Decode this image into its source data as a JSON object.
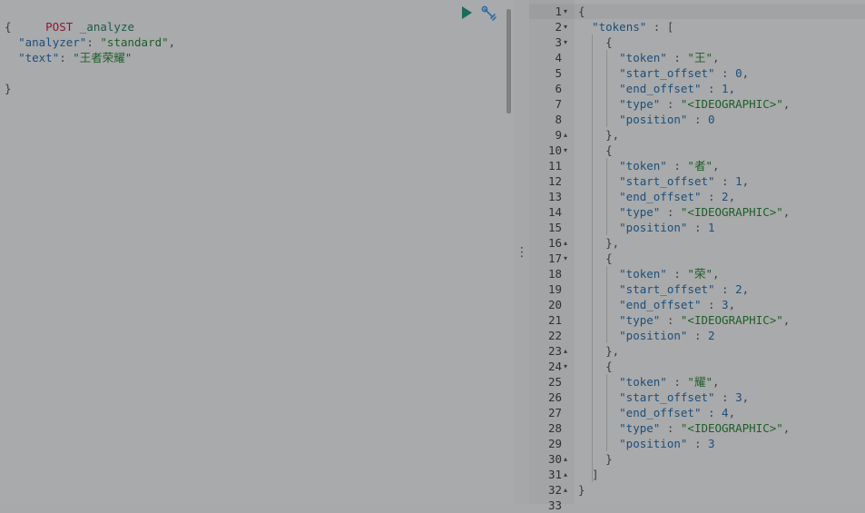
{
  "request": {
    "method": "POST",
    "path": "_analyze",
    "body_lines": [
      {
        "indent": "",
        "parts": [
          {
            "t": "{",
            "c": "brace"
          }
        ]
      },
      {
        "indent": "  ",
        "parts": [
          {
            "t": "\"analyzer\"",
            "c": "key"
          },
          {
            "t": ": ",
            "c": "punct"
          },
          {
            "t": "\"standard\"",
            "c": "str"
          },
          {
            "t": ",",
            "c": "punct"
          }
        ]
      },
      {
        "indent": "  ",
        "parts": [
          {
            "t": "\"text\"",
            "c": "key"
          },
          {
            "t": ": ",
            "c": "punct"
          },
          {
            "t": "\"王者荣耀\"",
            "c": "str"
          }
        ]
      },
      {
        "indent": "",
        "parts": []
      },
      {
        "indent": "",
        "parts": [
          {
            "t": "}",
            "c": "brace"
          }
        ]
      }
    ]
  },
  "actions": {
    "run_icon": "play-icon",
    "settings_icon": "wrench-icon",
    "run_color": "#1b6b5c",
    "settings_color": "#2b6ca8"
  },
  "divider": {
    "handle": "⋮"
  },
  "response": {
    "lines": [
      {
        "n": "1",
        "fold": "▾",
        "indent": "",
        "parts": [
          {
            "t": "{",
            "c": "brace"
          }
        ]
      },
      {
        "n": "2",
        "fold": "▾",
        "indent": "  ",
        "parts": [
          {
            "t": "\"tokens\"",
            "c": "key"
          },
          {
            "t": " : [",
            "c": "punct"
          }
        ]
      },
      {
        "n": "3",
        "fold": "▾",
        "indent": "    ",
        "parts": [
          {
            "t": "{",
            "c": "brace"
          }
        ]
      },
      {
        "n": "4",
        "fold": "",
        "indent": "      ",
        "parts": [
          {
            "t": "\"token\"",
            "c": "key"
          },
          {
            "t": " : ",
            "c": "punct"
          },
          {
            "t": "\"王\"",
            "c": "str"
          },
          {
            "t": ",",
            "c": "punct"
          }
        ]
      },
      {
        "n": "5",
        "fold": "",
        "indent": "      ",
        "parts": [
          {
            "t": "\"start_offset\"",
            "c": "key"
          },
          {
            "t": " : ",
            "c": "punct"
          },
          {
            "t": "0",
            "c": "num"
          },
          {
            "t": ",",
            "c": "punct"
          }
        ]
      },
      {
        "n": "6",
        "fold": "",
        "indent": "      ",
        "parts": [
          {
            "t": "\"end_offset\"",
            "c": "key"
          },
          {
            "t": " : ",
            "c": "punct"
          },
          {
            "t": "1",
            "c": "num"
          },
          {
            "t": ",",
            "c": "punct"
          }
        ]
      },
      {
        "n": "7",
        "fold": "",
        "indent": "      ",
        "parts": [
          {
            "t": "\"type\"",
            "c": "key"
          },
          {
            "t": " : ",
            "c": "punct"
          },
          {
            "t": "\"<IDEOGRAPHIC>\"",
            "c": "str"
          },
          {
            "t": ",",
            "c": "punct"
          }
        ]
      },
      {
        "n": "8",
        "fold": "",
        "indent": "      ",
        "parts": [
          {
            "t": "\"position\"",
            "c": "key"
          },
          {
            "t": " : ",
            "c": "punct"
          },
          {
            "t": "0",
            "c": "num"
          }
        ]
      },
      {
        "n": "9",
        "fold": "▴",
        "indent": "    ",
        "parts": [
          {
            "t": "},",
            "c": "brace"
          }
        ]
      },
      {
        "n": "10",
        "fold": "▾",
        "indent": "    ",
        "parts": [
          {
            "t": "{",
            "c": "brace"
          }
        ]
      },
      {
        "n": "11",
        "fold": "",
        "indent": "      ",
        "parts": [
          {
            "t": "\"token\"",
            "c": "key"
          },
          {
            "t": " : ",
            "c": "punct"
          },
          {
            "t": "\"者\"",
            "c": "str"
          },
          {
            "t": ",",
            "c": "punct"
          }
        ]
      },
      {
        "n": "12",
        "fold": "",
        "indent": "      ",
        "parts": [
          {
            "t": "\"start_offset\"",
            "c": "key"
          },
          {
            "t": " : ",
            "c": "punct"
          },
          {
            "t": "1",
            "c": "num"
          },
          {
            "t": ",",
            "c": "punct"
          }
        ]
      },
      {
        "n": "13",
        "fold": "",
        "indent": "      ",
        "parts": [
          {
            "t": "\"end_offset\"",
            "c": "key"
          },
          {
            "t": " : ",
            "c": "punct"
          },
          {
            "t": "2",
            "c": "num"
          },
          {
            "t": ",",
            "c": "punct"
          }
        ]
      },
      {
        "n": "14",
        "fold": "",
        "indent": "      ",
        "parts": [
          {
            "t": "\"type\"",
            "c": "key"
          },
          {
            "t": " : ",
            "c": "punct"
          },
          {
            "t": "\"<IDEOGRAPHIC>\"",
            "c": "str"
          },
          {
            "t": ",",
            "c": "punct"
          }
        ]
      },
      {
        "n": "15",
        "fold": "",
        "indent": "      ",
        "parts": [
          {
            "t": "\"position\"",
            "c": "key"
          },
          {
            "t": " : ",
            "c": "punct"
          },
          {
            "t": "1",
            "c": "num"
          }
        ]
      },
      {
        "n": "16",
        "fold": "▴",
        "indent": "    ",
        "parts": [
          {
            "t": "},",
            "c": "brace"
          }
        ]
      },
      {
        "n": "17",
        "fold": "▾",
        "indent": "    ",
        "parts": [
          {
            "t": "{",
            "c": "brace"
          }
        ]
      },
      {
        "n": "18",
        "fold": "",
        "indent": "      ",
        "parts": [
          {
            "t": "\"token\"",
            "c": "key"
          },
          {
            "t": " : ",
            "c": "punct"
          },
          {
            "t": "\"荣\"",
            "c": "str"
          },
          {
            "t": ",",
            "c": "punct"
          }
        ]
      },
      {
        "n": "19",
        "fold": "",
        "indent": "      ",
        "parts": [
          {
            "t": "\"start_offset\"",
            "c": "key"
          },
          {
            "t": " : ",
            "c": "punct"
          },
          {
            "t": "2",
            "c": "num"
          },
          {
            "t": ",",
            "c": "punct"
          }
        ]
      },
      {
        "n": "20",
        "fold": "",
        "indent": "      ",
        "parts": [
          {
            "t": "\"end_offset\"",
            "c": "key"
          },
          {
            "t": " : ",
            "c": "punct"
          },
          {
            "t": "3",
            "c": "num"
          },
          {
            "t": ",",
            "c": "punct"
          }
        ]
      },
      {
        "n": "21",
        "fold": "",
        "indent": "      ",
        "parts": [
          {
            "t": "\"type\"",
            "c": "key"
          },
          {
            "t": " : ",
            "c": "punct"
          },
          {
            "t": "\"<IDEOGRAPHIC>\"",
            "c": "str"
          },
          {
            "t": ",",
            "c": "punct"
          }
        ]
      },
      {
        "n": "22",
        "fold": "",
        "indent": "      ",
        "parts": [
          {
            "t": "\"position\"",
            "c": "key"
          },
          {
            "t": " : ",
            "c": "punct"
          },
          {
            "t": "2",
            "c": "num"
          }
        ]
      },
      {
        "n": "23",
        "fold": "▴",
        "indent": "    ",
        "parts": [
          {
            "t": "},",
            "c": "brace"
          }
        ]
      },
      {
        "n": "24",
        "fold": "▾",
        "indent": "    ",
        "parts": [
          {
            "t": "{",
            "c": "brace"
          }
        ]
      },
      {
        "n": "25",
        "fold": "",
        "indent": "      ",
        "parts": [
          {
            "t": "\"token\"",
            "c": "key"
          },
          {
            "t": " : ",
            "c": "punct"
          },
          {
            "t": "\"耀\"",
            "c": "str"
          },
          {
            "t": ",",
            "c": "punct"
          }
        ]
      },
      {
        "n": "26",
        "fold": "",
        "indent": "      ",
        "parts": [
          {
            "t": "\"start_offset\"",
            "c": "key"
          },
          {
            "t": " : ",
            "c": "punct"
          },
          {
            "t": "3",
            "c": "num"
          },
          {
            "t": ",",
            "c": "punct"
          }
        ]
      },
      {
        "n": "27",
        "fold": "",
        "indent": "      ",
        "parts": [
          {
            "t": "\"end_offset\"",
            "c": "key"
          },
          {
            "t": " : ",
            "c": "punct"
          },
          {
            "t": "4",
            "c": "num"
          },
          {
            "t": ",",
            "c": "punct"
          }
        ]
      },
      {
        "n": "28",
        "fold": "",
        "indent": "      ",
        "parts": [
          {
            "t": "\"type\"",
            "c": "key"
          },
          {
            "t": " : ",
            "c": "punct"
          },
          {
            "t": "\"<IDEOGRAPHIC>\"",
            "c": "str"
          },
          {
            "t": ",",
            "c": "punct"
          }
        ]
      },
      {
        "n": "29",
        "fold": "",
        "indent": "      ",
        "parts": [
          {
            "t": "\"position\"",
            "c": "key"
          },
          {
            "t": " : ",
            "c": "punct"
          },
          {
            "t": "3",
            "c": "num"
          }
        ]
      },
      {
        "n": "30",
        "fold": "▴",
        "indent": "    ",
        "parts": [
          {
            "t": "}",
            "c": "brace"
          }
        ]
      },
      {
        "n": "31",
        "fold": "▴",
        "indent": "  ",
        "parts": [
          {
            "t": "]",
            "c": "brace"
          }
        ]
      },
      {
        "n": "32",
        "fold": "▴",
        "indent": "",
        "parts": [
          {
            "t": "}",
            "c": "brace"
          }
        ]
      },
      {
        "n": "33",
        "fold": "",
        "indent": "",
        "parts": []
      }
    ]
  }
}
